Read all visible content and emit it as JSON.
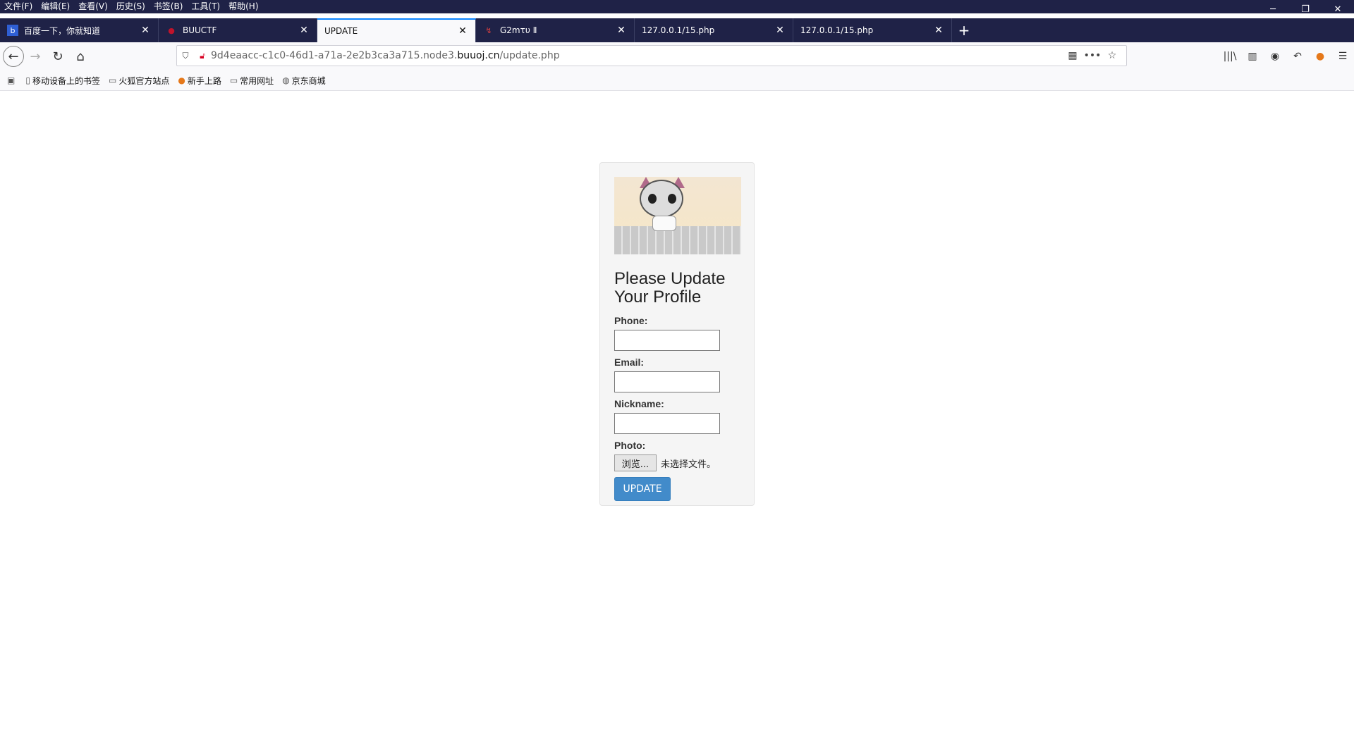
{
  "menubar": {
    "items": [
      "文件(F)",
      "编辑(E)",
      "查看(V)",
      "历史(S)",
      "书签(B)",
      "工具(T)",
      "帮助(H)"
    ]
  },
  "window_controls": {
    "minimize": "─",
    "restore": "❐",
    "close": "✕"
  },
  "tabs": [
    {
      "title": "百度一下，你就知道",
      "icon": "baidu-icon"
    },
    {
      "title": "BUUCTF",
      "icon": "buuctf-icon"
    },
    {
      "title": "UPDATE",
      "icon": "",
      "active": true
    },
    {
      "title": "G2mτυ Ⅱ",
      "icon": "g2-icon"
    },
    {
      "title": "127.0.0.1/15.php",
      "icon": ""
    },
    {
      "title": "127.0.0.1/15.php",
      "icon": ""
    }
  ],
  "tab_close": "✕",
  "new_tab": "+",
  "nav": {
    "back": "←",
    "forward": "→",
    "reload": "↻",
    "home": "⌂"
  },
  "url": {
    "prefix": "9d4eaacc-c1c0-46d1-a71a-2e2b3ca3a715.node3.",
    "host": "buuoj.cn",
    "path": "/update.php"
  },
  "bookmarks": [
    {
      "label": "移动设备上的书签",
      "icon": "mobile-icon"
    },
    {
      "label": "火狐官方站点",
      "icon": "folder-icon"
    },
    {
      "label": "新手上路",
      "icon": "firefox-icon"
    },
    {
      "label": "常用网址",
      "icon": "folder-icon"
    },
    {
      "label": "京东商城",
      "icon": "globe-icon"
    }
  ],
  "form": {
    "title": "Please Update Your Profile",
    "phone_label": "Phone:",
    "email_label": "Email:",
    "nickname_label": "Nickname:",
    "photo_label": "Photo:",
    "browse_label": "浏览...",
    "no_file_text": "未选择文件。",
    "submit_label": "UPDATE"
  },
  "colors": {
    "chrome": "#1f2247",
    "accent": "#0a84ff",
    "submit": "#428bca"
  }
}
